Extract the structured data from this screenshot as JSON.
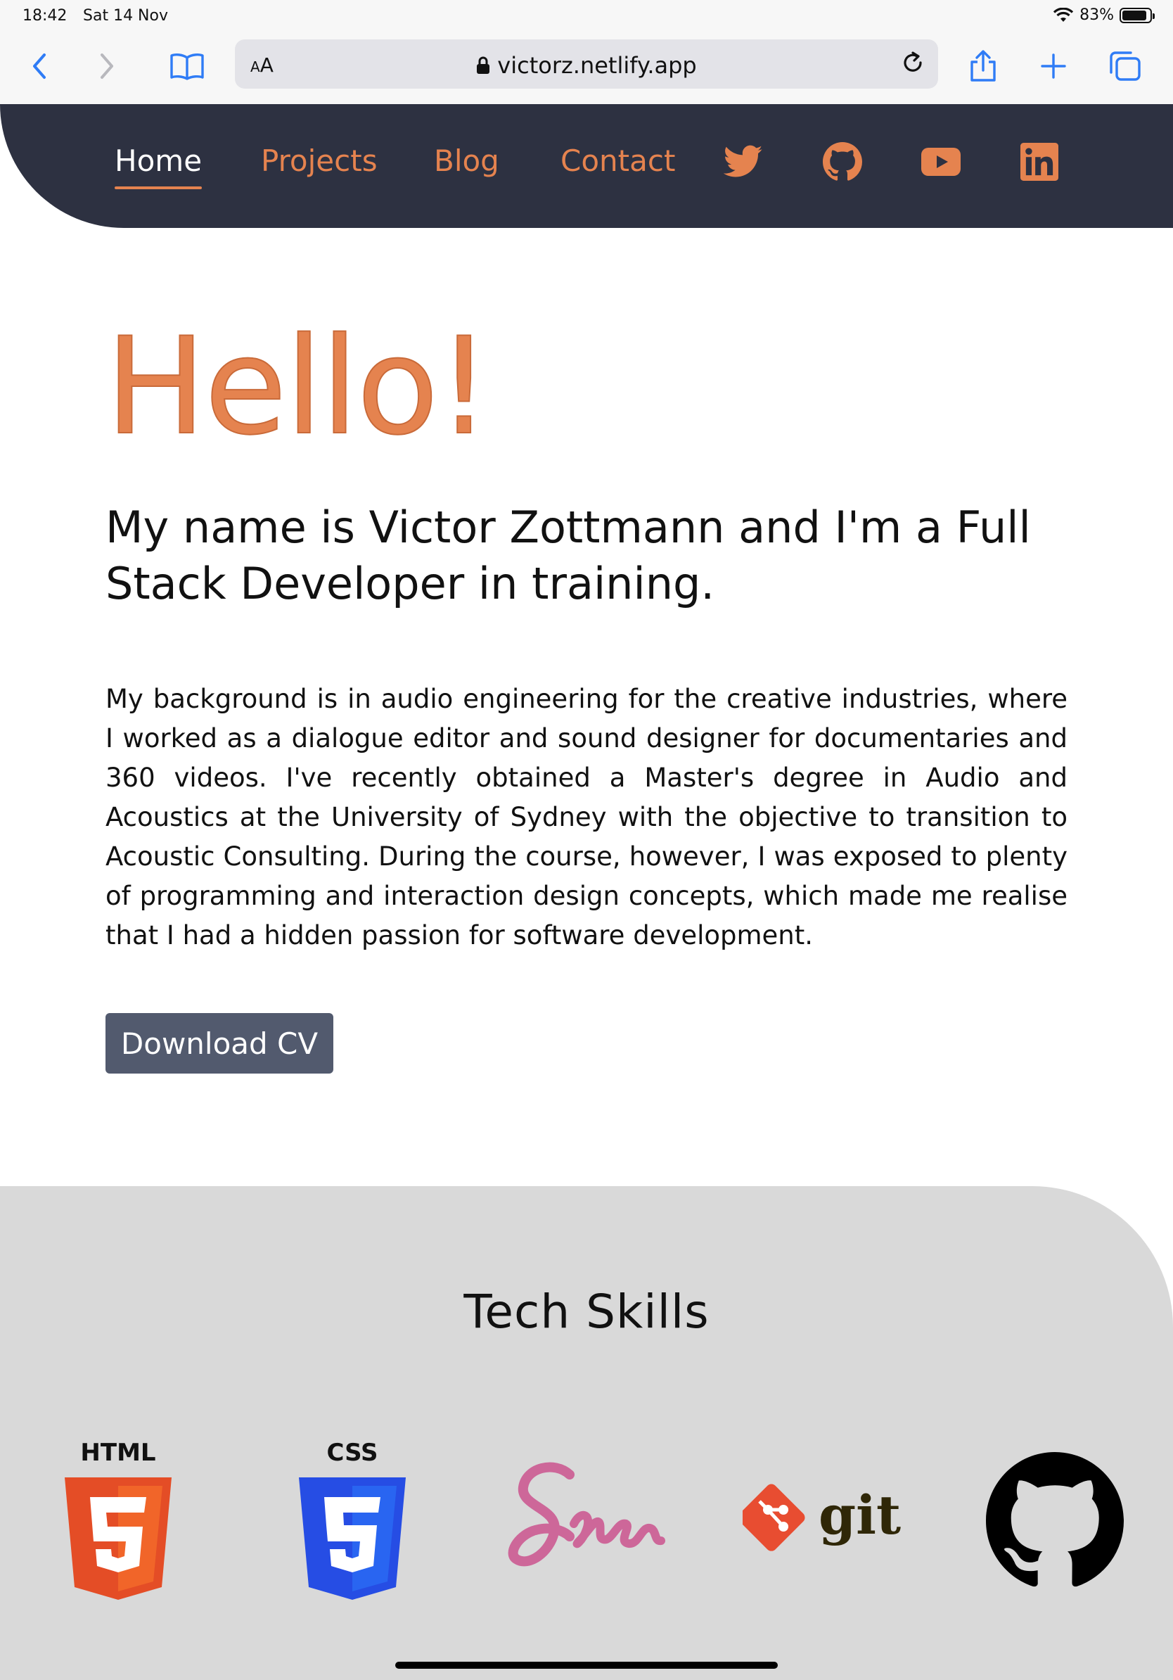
{
  "status_bar": {
    "time": "18:42",
    "date": "Sat 14 Nov",
    "battery": "83%",
    "battery_level": 0.83
  },
  "browser": {
    "text_size_label": "AA",
    "url": "victorz.netlify.app"
  },
  "nav": {
    "items": [
      {
        "label": "Home",
        "active": true
      },
      {
        "label": "Projects",
        "active": false
      },
      {
        "label": "Blog",
        "active": false
      },
      {
        "label": "Contact",
        "active": false
      }
    ],
    "social_icons": [
      "twitter-icon",
      "github-icon",
      "youtube-icon",
      "linkedin-icon"
    ],
    "accent_color": "#e5834f",
    "bg_color": "#2d3141"
  },
  "hero": {
    "greeting": "Hello!",
    "intro": "My name is Victor Zottmann and I'm a Full Stack Developer in training.",
    "bio": "My background is in audio engineering for the creative industries, where I worked as a dialogue editor and sound designer for documentaries and 360 videos. I've recently obtained a Master's degree in Audio and Acoustics at the University of Sydney with the objective to transition to Acoustic Consulting. During the course, however, I was exposed to plenty of programming and interaction design concepts, which made me realise that I had a hidden passion for software development.",
    "cv_button": "Download CV"
  },
  "skills": {
    "title": "Tech Skills",
    "html_label": "HTML",
    "css_label": "CSS",
    "git_label": "git",
    "logos": [
      "html5-logo",
      "css3-logo",
      "sass-logo",
      "git-logo",
      "github-logo"
    ]
  }
}
